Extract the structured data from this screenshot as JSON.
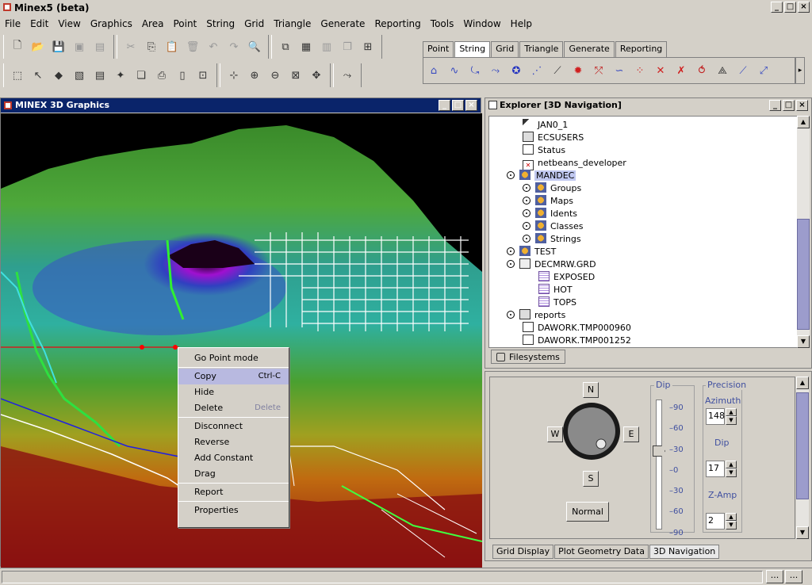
{
  "app": {
    "title": "Minex5 (beta)"
  },
  "menu": [
    "File",
    "Edit",
    "View",
    "Graphics",
    "Area",
    "Point",
    "String",
    "Grid",
    "Triangle",
    "Generate",
    "Reporting",
    "Tools",
    "Window",
    "Help"
  ],
  "mode_tabs": [
    "Point",
    "String",
    "Grid",
    "Triangle",
    "Generate",
    "Reporting"
  ],
  "mode_tab_selected": "String",
  "graphics_window": {
    "title": "MINEX 3D Graphics"
  },
  "context_menu": {
    "items": [
      {
        "label": "Go Point mode"
      },
      {
        "sep": true
      },
      {
        "label": "Copy",
        "shortcut": "Ctrl-C",
        "selected": true
      },
      {
        "label": "Hide"
      },
      {
        "label": "Delete",
        "shortcut": "Delete"
      },
      {
        "sep": true
      },
      {
        "label": "Disconnect"
      },
      {
        "label": "Reverse"
      },
      {
        "label": "Add Constant"
      },
      {
        "label": "Drag"
      },
      {
        "sep": true
      },
      {
        "label": "Report"
      },
      {
        "sep": true
      },
      {
        "label": "Properties"
      }
    ]
  },
  "explorer": {
    "title": "Explorer [3D Navigation]",
    "tree": [
      {
        "label": "JAN0_1",
        "icon": "tool-icon",
        "level": 1
      },
      {
        "label": "ECSUSERS",
        "icon": "group-icon",
        "level": 1
      },
      {
        "label": "Status",
        "icon": "doc-icon",
        "level": 1
      },
      {
        "label": "netbeans_developer",
        "icon": "pdf-icon",
        "level": 1
      },
      {
        "label": "MANDEC",
        "icon": "folder-people-icon",
        "level": 1,
        "selected": true
      },
      {
        "label": "Groups",
        "icon": "people-icon",
        "level": 2
      },
      {
        "label": "Maps",
        "icon": "people-icon",
        "level": 2
      },
      {
        "label": "Idents",
        "icon": "people-icon",
        "level": 2
      },
      {
        "label": "Classes",
        "icon": "people-icon",
        "level": 2
      },
      {
        "label": "Strings",
        "icon": "people-icon",
        "level": 2
      },
      {
        "label": "TEST",
        "icon": "people-icon",
        "level": 1
      },
      {
        "label": "DECMRW.GRD",
        "icon": "folder-open-icon",
        "level": 1
      },
      {
        "label": "EXPOSED",
        "icon": "grid-icon",
        "level": 2
      },
      {
        "label": "HOT",
        "icon": "grid-icon",
        "level": 2
      },
      {
        "label": "TOPS",
        "icon": "grid-icon",
        "level": 2
      },
      {
        "label": "reports",
        "icon": "folder-icon",
        "level": 1
      },
      {
        "label": "DAWORK.TMP000960",
        "icon": "doc-icon",
        "level": 1
      },
      {
        "label": "DAWORK.TMP001252",
        "icon": "doc-icon",
        "level": 1
      }
    ],
    "filesystems_tab": "Filesystems"
  },
  "navigation": {
    "compass": {
      "n": "N",
      "s": "S",
      "e": "E",
      "w": "W"
    },
    "normal_button": "Normal",
    "dip_group": "Dip",
    "dip_ticks": [
      "90",
      "60",
      "30",
      "0",
      "30",
      "60",
      "90"
    ],
    "precision_group": "Precision",
    "azimuth_label": "Azimuth",
    "azimuth_value": "148",
    "dip_label": "Dip",
    "dip_value": "17",
    "zamp_label": "Z-Amp",
    "zamp_value": "2",
    "bottom_tabs": [
      "Grid Display",
      "Plot Geometry Data",
      "3D Navigation"
    ],
    "bottom_tab_selected": "3D Navigation"
  },
  "status": {
    "btn1": "...",
    "btn2": "..."
  }
}
